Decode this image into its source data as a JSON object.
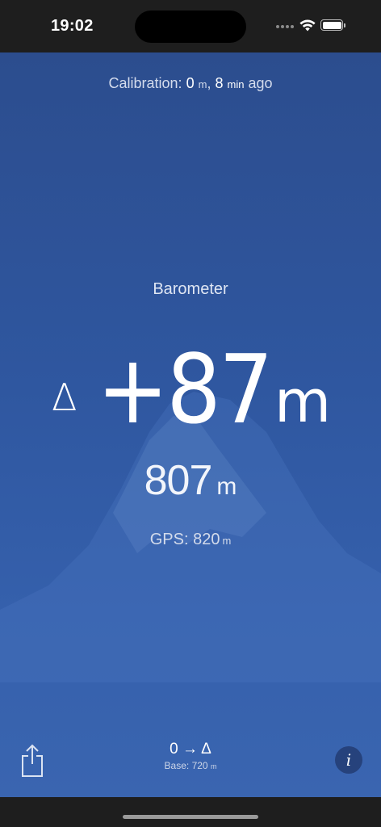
{
  "status_bar": {
    "time": "19:02"
  },
  "calibration": {
    "prefix": "Calibration: ",
    "offset_value": "0",
    "offset_unit": "m",
    "separator": ", ",
    "age_value": "8",
    "age_unit": "min",
    "age_suffix": " ago"
  },
  "reading": {
    "title": "Barometer",
    "delta_symbol": "Δ",
    "delta_value": "+87",
    "delta_unit": "m",
    "altitude_value": "807",
    "altitude_unit": "m",
    "gps_label": "GPS: 820",
    "gps_unit": "m"
  },
  "footer": {
    "mode_label": "0 → Δ",
    "base_label": "Base: 720",
    "base_unit": "m",
    "info_label": "i"
  },
  "colors": {
    "background_top": "#2c4d8e",
    "background_bottom": "#3a65b0",
    "status_bar": "#1e1e1e"
  },
  "icons": {
    "share": "share-icon",
    "wifi": "wifi-icon",
    "battery": "battery-icon",
    "signal": "signal-icon",
    "background": "mountain-icon"
  }
}
